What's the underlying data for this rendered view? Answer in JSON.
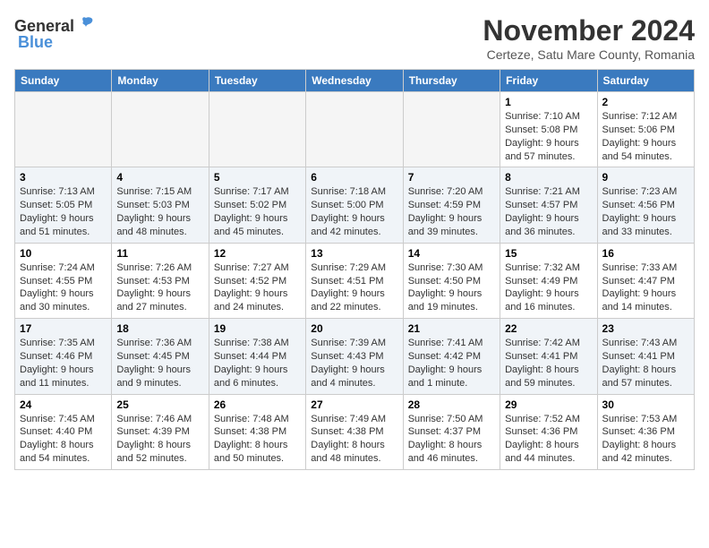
{
  "header": {
    "logo_general": "General",
    "logo_blue": "Blue",
    "month_title": "November 2024",
    "subtitle": "Certeze, Satu Mare County, Romania"
  },
  "weekdays": [
    "Sunday",
    "Monday",
    "Tuesday",
    "Wednesday",
    "Thursday",
    "Friday",
    "Saturday"
  ],
  "weeks": [
    [
      {
        "day": "",
        "empty": true
      },
      {
        "day": "",
        "empty": true
      },
      {
        "day": "",
        "empty": true
      },
      {
        "day": "",
        "empty": true
      },
      {
        "day": "",
        "empty": true
      },
      {
        "day": "1",
        "sunrise": "7:10 AM",
        "sunset": "5:08 PM",
        "daylight": "9 hours and 57 minutes."
      },
      {
        "day": "2",
        "sunrise": "7:12 AM",
        "sunset": "5:06 PM",
        "daylight": "9 hours and 54 minutes."
      }
    ],
    [
      {
        "day": "3",
        "sunrise": "7:13 AM",
        "sunset": "5:05 PM",
        "daylight": "9 hours and 51 minutes."
      },
      {
        "day": "4",
        "sunrise": "7:15 AM",
        "sunset": "5:03 PM",
        "daylight": "9 hours and 48 minutes."
      },
      {
        "day": "5",
        "sunrise": "7:17 AM",
        "sunset": "5:02 PM",
        "daylight": "9 hours and 45 minutes."
      },
      {
        "day": "6",
        "sunrise": "7:18 AM",
        "sunset": "5:00 PM",
        "daylight": "9 hours and 42 minutes."
      },
      {
        "day": "7",
        "sunrise": "7:20 AM",
        "sunset": "4:59 PM",
        "daylight": "9 hours and 39 minutes."
      },
      {
        "day": "8",
        "sunrise": "7:21 AM",
        "sunset": "4:57 PM",
        "daylight": "9 hours and 36 minutes."
      },
      {
        "day": "9",
        "sunrise": "7:23 AM",
        "sunset": "4:56 PM",
        "daylight": "9 hours and 33 minutes."
      }
    ],
    [
      {
        "day": "10",
        "sunrise": "7:24 AM",
        "sunset": "4:55 PM",
        "daylight": "9 hours and 30 minutes."
      },
      {
        "day": "11",
        "sunrise": "7:26 AM",
        "sunset": "4:53 PM",
        "daylight": "9 hours and 27 minutes."
      },
      {
        "day": "12",
        "sunrise": "7:27 AM",
        "sunset": "4:52 PM",
        "daylight": "9 hours and 24 minutes."
      },
      {
        "day": "13",
        "sunrise": "7:29 AM",
        "sunset": "4:51 PM",
        "daylight": "9 hours and 22 minutes."
      },
      {
        "day": "14",
        "sunrise": "7:30 AM",
        "sunset": "4:50 PM",
        "daylight": "9 hours and 19 minutes."
      },
      {
        "day": "15",
        "sunrise": "7:32 AM",
        "sunset": "4:49 PM",
        "daylight": "9 hours and 16 minutes."
      },
      {
        "day": "16",
        "sunrise": "7:33 AM",
        "sunset": "4:47 PM",
        "daylight": "9 hours and 14 minutes."
      }
    ],
    [
      {
        "day": "17",
        "sunrise": "7:35 AM",
        "sunset": "4:46 PM",
        "daylight": "9 hours and 11 minutes."
      },
      {
        "day": "18",
        "sunrise": "7:36 AM",
        "sunset": "4:45 PM",
        "daylight": "9 hours and 9 minutes."
      },
      {
        "day": "19",
        "sunrise": "7:38 AM",
        "sunset": "4:44 PM",
        "daylight": "9 hours and 6 minutes."
      },
      {
        "day": "20",
        "sunrise": "7:39 AM",
        "sunset": "4:43 PM",
        "daylight": "9 hours and 4 minutes."
      },
      {
        "day": "21",
        "sunrise": "7:41 AM",
        "sunset": "4:42 PM",
        "daylight": "9 hours and 1 minute."
      },
      {
        "day": "22",
        "sunrise": "7:42 AM",
        "sunset": "4:41 PM",
        "daylight": "8 hours and 59 minutes."
      },
      {
        "day": "23",
        "sunrise": "7:43 AM",
        "sunset": "4:41 PM",
        "daylight": "8 hours and 57 minutes."
      }
    ],
    [
      {
        "day": "24",
        "sunrise": "7:45 AM",
        "sunset": "4:40 PM",
        "daylight": "8 hours and 54 minutes."
      },
      {
        "day": "25",
        "sunrise": "7:46 AM",
        "sunset": "4:39 PM",
        "daylight": "8 hours and 52 minutes."
      },
      {
        "day": "26",
        "sunrise": "7:48 AM",
        "sunset": "4:38 PM",
        "daylight": "8 hours and 50 minutes."
      },
      {
        "day": "27",
        "sunrise": "7:49 AM",
        "sunset": "4:38 PM",
        "daylight": "8 hours and 48 minutes."
      },
      {
        "day": "28",
        "sunrise": "7:50 AM",
        "sunset": "4:37 PM",
        "daylight": "8 hours and 46 minutes."
      },
      {
        "day": "29",
        "sunrise": "7:52 AM",
        "sunset": "4:36 PM",
        "daylight": "8 hours and 44 minutes."
      },
      {
        "day": "30",
        "sunrise": "7:53 AM",
        "sunset": "4:36 PM",
        "daylight": "8 hours and 42 minutes."
      }
    ]
  ]
}
